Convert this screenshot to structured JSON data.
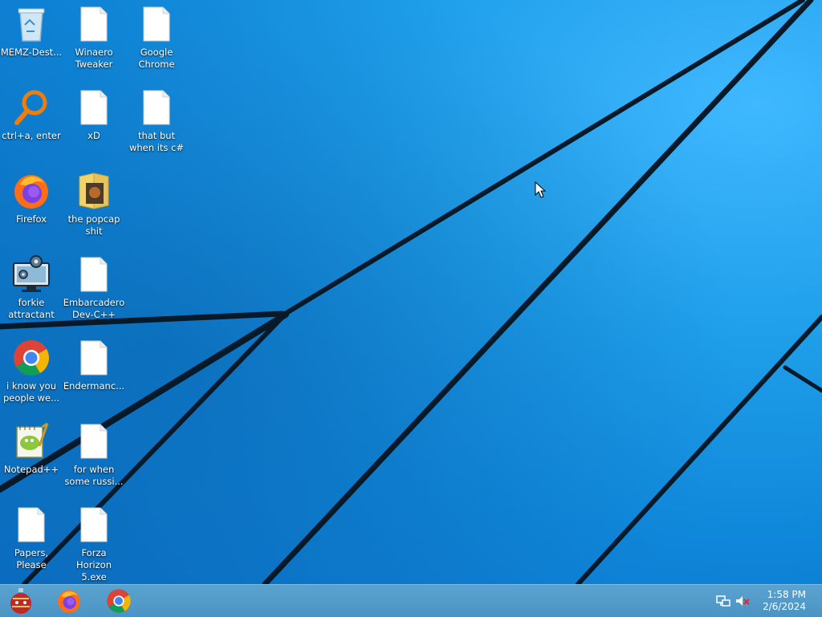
{
  "desktop_icons": [
    {
      "label": "MEMZ-Dest...",
      "icon": "recycle-bin-icon"
    },
    {
      "label": "Winaero Tweaker",
      "icon": "file-icon"
    },
    {
      "label": "Google Chrome",
      "icon": "file-icon"
    },
    {
      "label": "ctrl+a, enter",
      "icon": "magnifier-icon"
    },
    {
      "label": "xD",
      "icon": "file-icon"
    },
    {
      "label": "that but when its c#",
      "icon": "file-icon"
    },
    {
      "label": "Firefox",
      "icon": "firefox-icon"
    },
    {
      "label": "the popcap shit",
      "icon": "folder-icon"
    },
    {
      "label": "forkie attractant",
      "icon": "monitor-gear-icon"
    },
    {
      "label": "Embarcadero Dev-C++",
      "icon": "file-icon"
    },
    {
      "label": "i know you people we...",
      "icon": "chrome-icon"
    },
    {
      "label": "Endermanc...",
      "icon": "file-icon"
    },
    {
      "label": "Notepad++",
      "icon": "notepadpp-icon"
    },
    {
      "label": "for when some russi...",
      "icon": "file-icon"
    },
    {
      "label": "Papers, Please",
      "icon": "file-icon"
    },
    {
      "label": "Forza Horizon 5.exe",
      "icon": "file-icon"
    }
  ],
  "taskbar": {
    "pinned": [
      {
        "name": "start",
        "icon": "ornament-start-icon"
      },
      {
        "name": "firefox",
        "icon": "firefox-icon"
      },
      {
        "name": "chrome",
        "icon": "chrome-icon"
      }
    ],
    "tray": {
      "network_icon": "network-icon",
      "volume_icon": "volume-muted-icon",
      "time": "1:58 PM",
      "date": "2/6/2024"
    }
  },
  "colors": {
    "accent": "#1e9ee9",
    "taskbar": "#4b93c4"
  }
}
